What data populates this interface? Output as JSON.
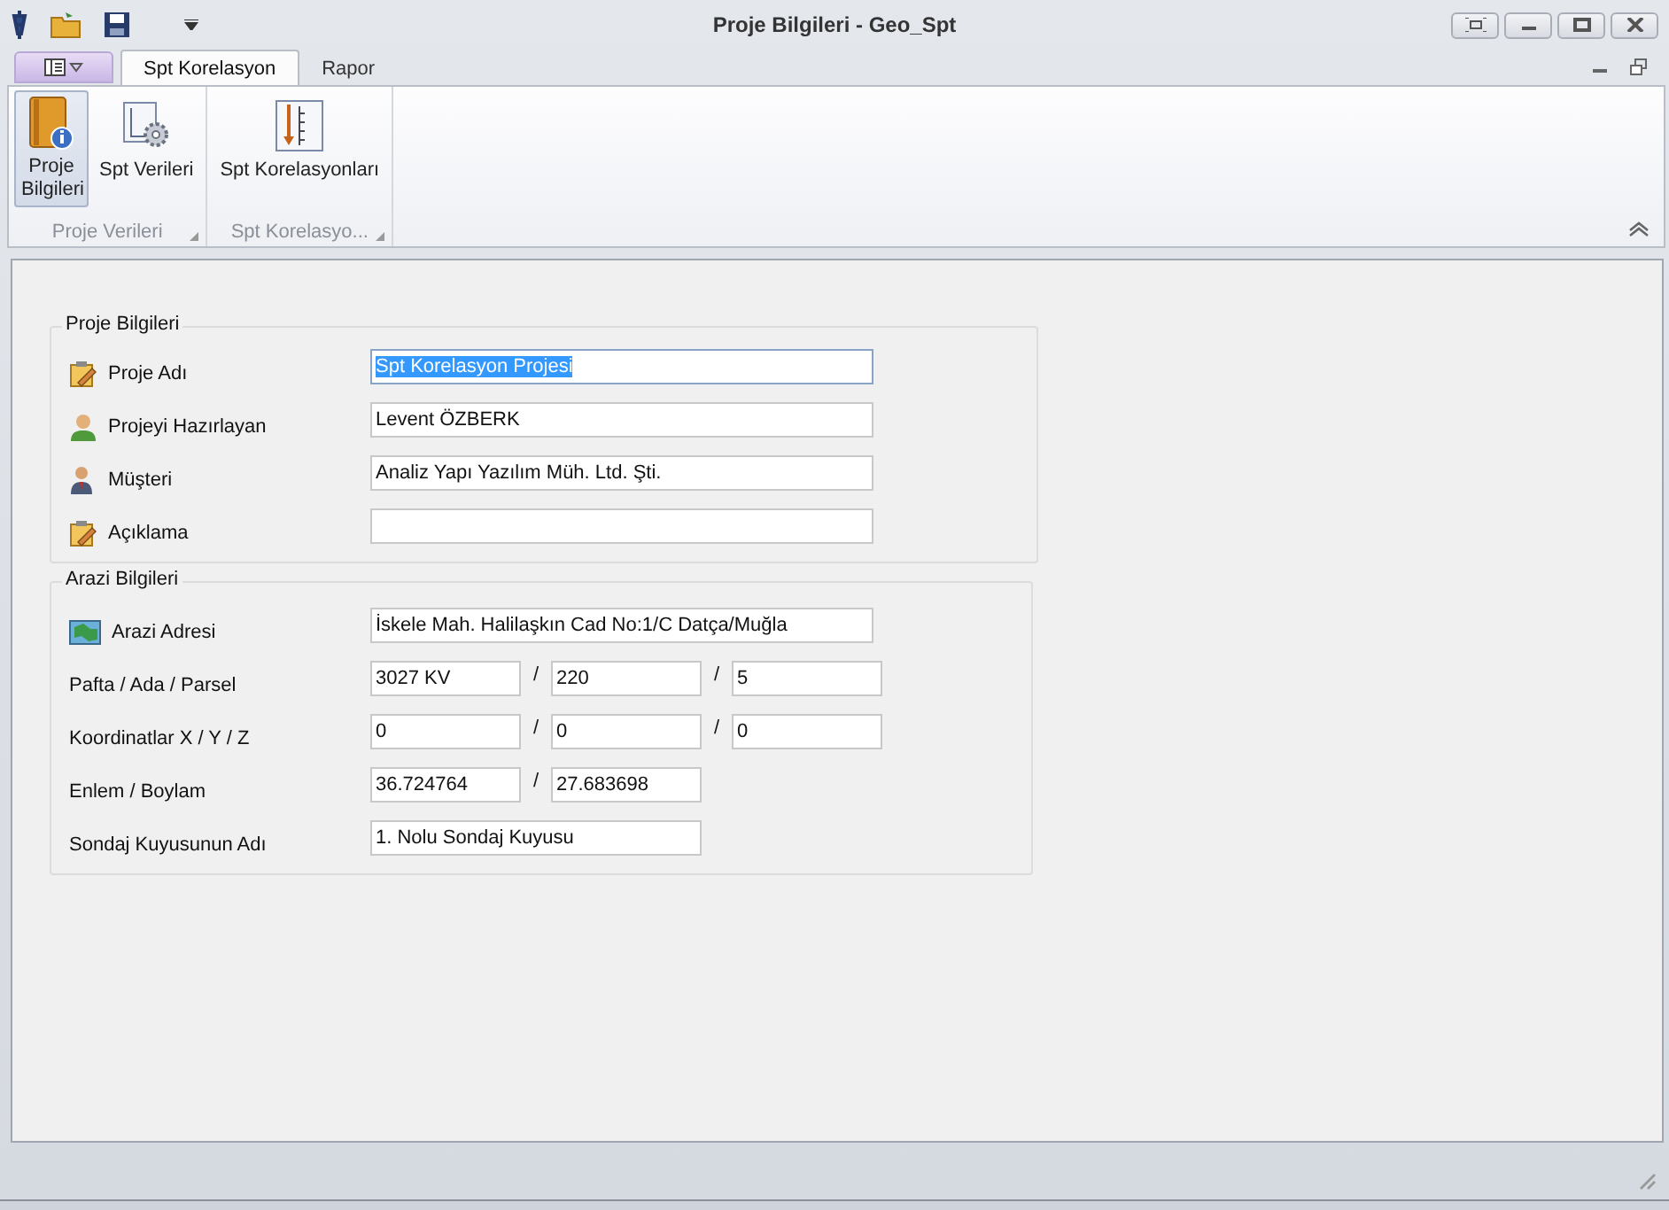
{
  "window": {
    "title": "Proje Bilgileri - Geo_Spt"
  },
  "tabs": [
    {
      "label": "Spt Korelasyon",
      "selected": true
    },
    {
      "label": "Rapor",
      "selected": false
    }
  ],
  "ribbon": {
    "groups": [
      {
        "label": "Proje Verileri",
        "buttons": [
          {
            "label": "Proje Bilgileri",
            "selected": true
          },
          {
            "label": "Spt Verileri",
            "selected": false
          }
        ]
      },
      {
        "label": "Spt Korelasyo...",
        "buttons": [
          {
            "label": "Spt Korelasyonları",
            "selected": false
          }
        ]
      }
    ]
  },
  "sections": [
    {
      "title": "Proje Bilgileri",
      "fields": [
        {
          "label": "Proje Adı",
          "kind": "long",
          "values": [
            "Spt Korelasyon Projesi"
          ],
          "highlighted": true
        },
        {
          "label": "Projeyi Hazırlayan",
          "kind": "long",
          "values": [
            "Levent ÖZBERK"
          ],
          "highlighted": false
        },
        {
          "label": "Müşteri",
          "kind": "long",
          "values": [
            "Analiz Yapı Yazılım Müh. Ltd. Şti."
          ],
          "highlighted": false
        },
        {
          "label": "Açıklama",
          "kind": "long",
          "highlighted": false
        }
      ]
    },
    {
      "title": "Arazi Bilgileri",
      "fields": [
        {
          "label": "Arazi Adresi",
          "kind": "long",
          "values": [
            "İskele Mah. Halilaşkın Cad No:1/C Datça/Muğla"
          ],
          "highlighted": false
        },
        {
          "label": "Pafta / Ada / Parsel",
          "kind": "split",
          "values": [
            "3027 KV",
            "220",
            "5"
          ],
          "highlighted": false
        },
        {
          "label": "Koordinatlar X / Y / Z",
          "kind": "split",
          "values": [
            "0",
            "0",
            "0"
          ],
          "highlighted": false
        },
        {
          "label": "Enlem / Boylam",
          "kind": "split",
          "values": [
            "36.724764",
            "27.683698"
          ],
          "highlighted": false
        },
        {
          "label": "Sondaj Kuyusunun Adı",
          "kind": "medium",
          "values": [
            "1. Nolu Sondaj Kuyusu"
          ],
          "highlighted": false
        }
      ]
    }
  ],
  "separator": "/"
}
